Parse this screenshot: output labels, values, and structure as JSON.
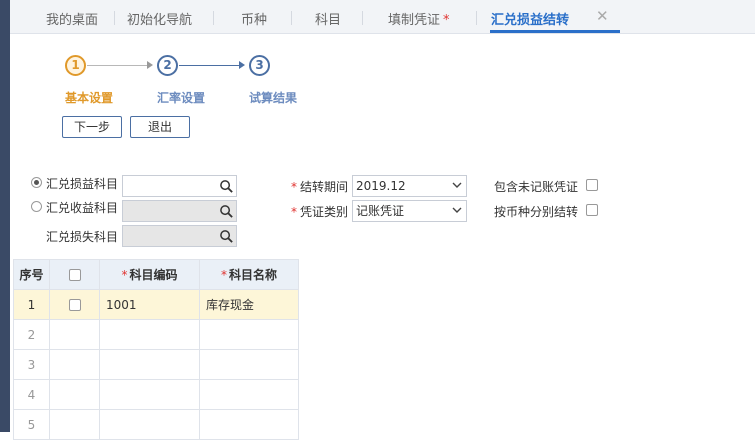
{
  "tabs": [
    {
      "label": "我的桌面"
    },
    {
      "label": "初始化导航"
    },
    {
      "label": "币种"
    },
    {
      "label": "科目"
    },
    {
      "label": "填制凭证",
      "required_mark": "*"
    },
    {
      "label": "汇兑损益结转"
    }
  ],
  "close_glyph": "✕",
  "steps": [
    {
      "number": "1",
      "label": "基本设置",
      "state": "current"
    },
    {
      "number": "2",
      "label": "汇率设置",
      "state": "pending"
    },
    {
      "number": "3",
      "label": "试算结果",
      "state": "pending"
    }
  ],
  "buttons": {
    "next": "下一步",
    "exit": "退出"
  },
  "form": {
    "subject_radios": [
      {
        "label": "汇兑损益科目",
        "checked": true,
        "value": ""
      },
      {
        "label": "汇兑收益科目",
        "checked": false,
        "value": ""
      }
    ],
    "loss_subject_label": "汇兑损失科目",
    "period": {
      "star": "*",
      "label": "结转期间",
      "value": "2019.12"
    },
    "voucher_type": {
      "star": "*",
      "label": "凭证类别",
      "value": "记账凭证"
    },
    "include_unposted": {
      "label": "包含未记账凭证",
      "checked": false
    },
    "by_currency": {
      "label": "按币种分别结转",
      "checked": false
    }
  },
  "grid": {
    "headers": {
      "seq": "序号",
      "code": "科目编码",
      "name": "科目名称",
      "star": "*"
    },
    "rows": [
      {
        "seq": "1",
        "code": "1001",
        "name": "库存现金"
      },
      {
        "seq": "2",
        "code": "",
        "name": ""
      },
      {
        "seq": "3",
        "code": "",
        "name": ""
      },
      {
        "seq": "4",
        "code": "",
        "name": ""
      },
      {
        "seq": "5",
        "code": "",
        "name": ""
      }
    ]
  },
  "colors": {
    "accent": "#2a6fc9",
    "step_done": "#e0992a",
    "required": "#e0322f",
    "selected_row": "#fdf6d8"
  }
}
